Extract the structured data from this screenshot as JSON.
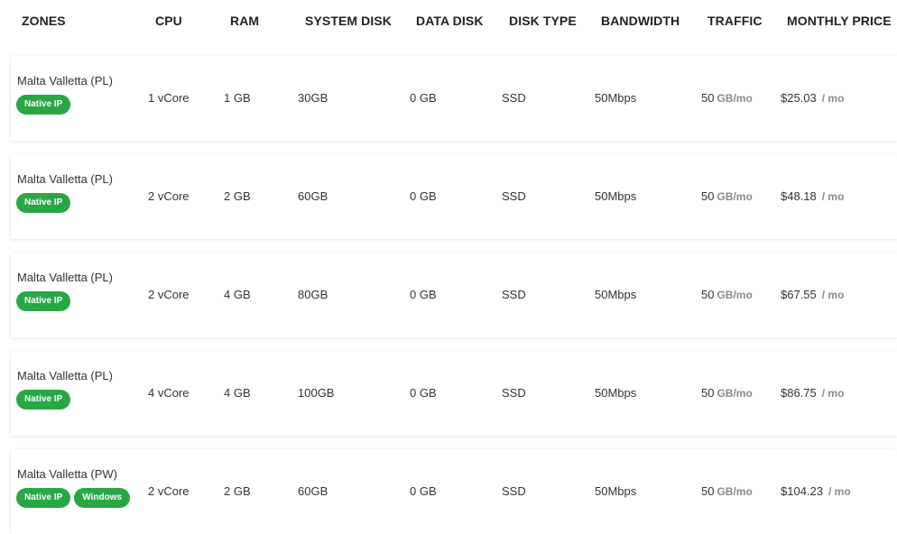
{
  "header": {
    "zones": "ZONES",
    "cpu": "CPU",
    "ram": "RAM",
    "system_disk": "SYSTEM DISK",
    "data_disk": "DATA DISK",
    "disk_type": "DISK TYPE",
    "bandwidth": "BANDWIDTH",
    "traffic": "TRAFFIC",
    "monthly_price": "MONTHLY PRICE"
  },
  "rows": [
    {
      "zone": "Malta Valletta (PL)",
      "badges": [
        "Native IP"
      ],
      "cpu": "1 vCore",
      "ram": "1 GB",
      "system_disk": "30GB",
      "data_disk": "0 GB",
      "disk_type": "SSD",
      "bandwidth": "50Mbps",
      "traffic": "50",
      "traffic_unit": "GB/mo",
      "price": "$25.03",
      "price_unit": "/ mo"
    },
    {
      "zone": "Malta Valletta (PL)",
      "badges": [
        "Native IP"
      ],
      "cpu": "2 vCore",
      "ram": "2 GB",
      "system_disk": "60GB",
      "data_disk": "0 GB",
      "disk_type": "SSD",
      "bandwidth": "50Mbps",
      "traffic": "50",
      "traffic_unit": "GB/mo",
      "price": "$48.18",
      "price_unit": "/ mo"
    },
    {
      "zone": "Malta Valletta (PL)",
      "badges": [
        "Native IP"
      ],
      "cpu": "2 vCore",
      "ram": "4 GB",
      "system_disk": "80GB",
      "data_disk": "0 GB",
      "disk_type": "SSD",
      "bandwidth": "50Mbps",
      "traffic": "50",
      "traffic_unit": "GB/mo",
      "price": "$67.55",
      "price_unit": "/ mo"
    },
    {
      "zone": "Malta Valletta (PL)",
      "badges": [
        "Native IP"
      ],
      "cpu": "4 vCore",
      "ram": "4 GB",
      "system_disk": "100GB",
      "data_disk": "0 GB",
      "disk_type": "SSD",
      "bandwidth": "50Mbps",
      "traffic": "50",
      "traffic_unit": "GB/mo",
      "price": "$86.75",
      "price_unit": "/ mo"
    },
    {
      "zone": "Malta Valletta (PW)",
      "badges": [
        "Native IP",
        "Windows"
      ],
      "cpu": "2 vCore",
      "ram": "2 GB",
      "system_disk": "60GB",
      "data_disk": "0 GB",
      "disk_type": "SSD",
      "bandwidth": "50Mbps",
      "traffic": "50",
      "traffic_unit": "GB/mo",
      "price": "$104.23",
      "price_unit": "/ mo"
    }
  ],
  "colors": {
    "badge_green": "#28a745",
    "muted_unit": "#8a8a8a"
  }
}
